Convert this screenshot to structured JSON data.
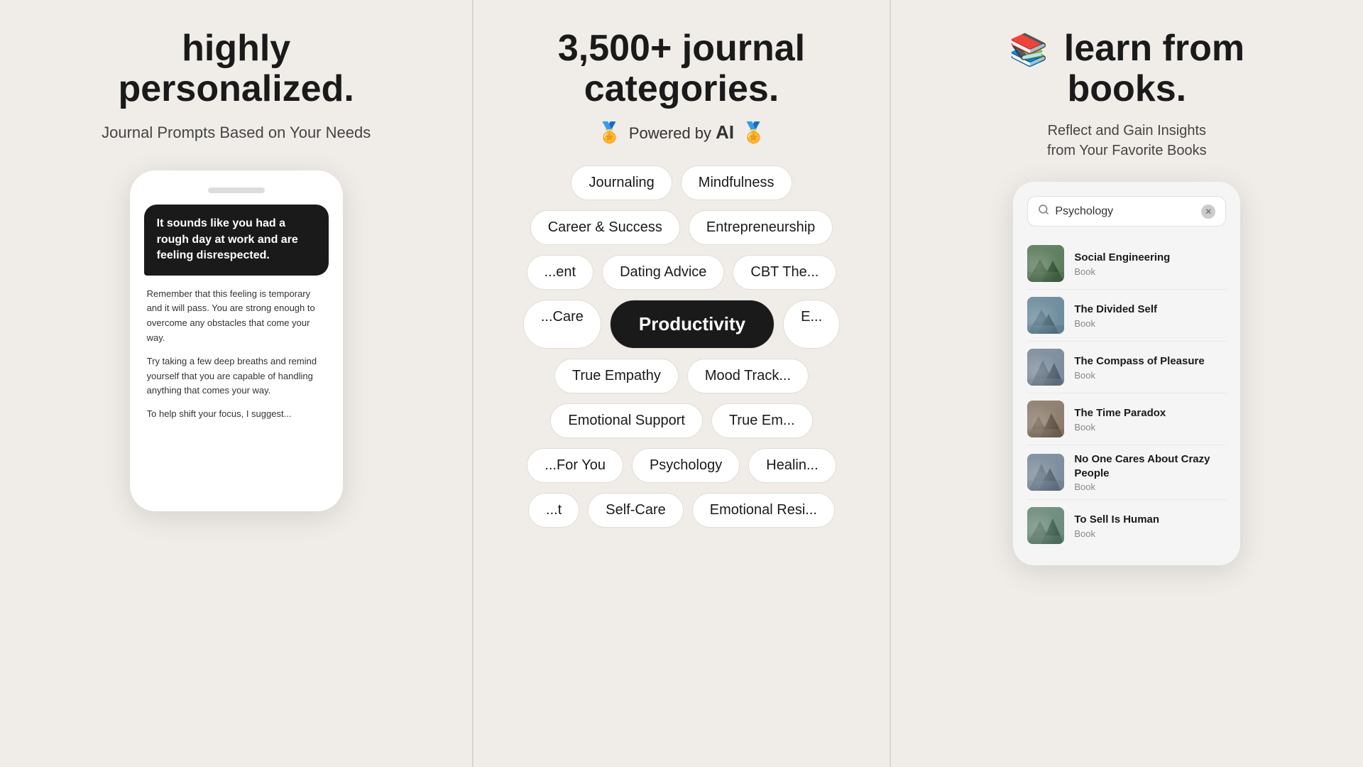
{
  "panel1": {
    "headline": "highly\npersonalized.",
    "subheadline": "Journal Prompts Based\non Your Needs",
    "chat_bubble": "It sounds like you had a rough day at work and are feeling disrespected.",
    "body_text1": "Remember that this feeling is temporary and it will pass. You are strong enough to overcome any obstacles that come your way.",
    "body_text2": "Try taking a few deep breaths and remind yourself that you are capable of handling anything that comes your way.",
    "body_text3": "To help shift your focus, I suggest..."
  },
  "panel2": {
    "headline": "3,500+ journal\ncategories.",
    "ai_label": "Powered\nby AI",
    "tags_rows": [
      [
        "Journaling",
        "Mindfulness"
      ],
      [
        "Career & Success",
        "Entrepreneurship"
      ],
      [
        "...ent",
        "Dating Advice",
        "CBT The..."
      ],
      [
        "...Care",
        "Productivity",
        "E..."
      ],
      [
        "True Empathy",
        "Mood Track..."
      ],
      [
        "Emotional Support",
        "True Em..."
      ],
      [
        "...For You",
        "Psychology",
        "Healin..."
      ],
      [
        "...t",
        "Self-Care",
        "Emotional Resi..."
      ]
    ],
    "featured_tag": "Productivity"
  },
  "panel3": {
    "headline1": "learn from",
    "headline2": "books.",
    "subheadline": "Reflect and Gain Insights\nfrom Your Favorite Books",
    "search_placeholder": "Psychology",
    "books": [
      {
        "title": "Social Engineering",
        "type": "Book",
        "cover": "1"
      },
      {
        "title": "The Divided Self",
        "type": "Book",
        "cover": "2"
      },
      {
        "title": "The Compass of Pleasure",
        "type": "Book",
        "cover": "3"
      },
      {
        "title": "The Time Paradox",
        "type": "Book",
        "cover": "4"
      },
      {
        "title": "No One Cares About Crazy People",
        "type": "Book",
        "cover": "5"
      },
      {
        "title": "To Sell Is Human",
        "type": "Book",
        "cover": "6"
      }
    ]
  },
  "colors": {
    "background": "#f0ede8",
    "dark": "#1a1a1a",
    "text": "#333333",
    "subtle": "#888888"
  }
}
